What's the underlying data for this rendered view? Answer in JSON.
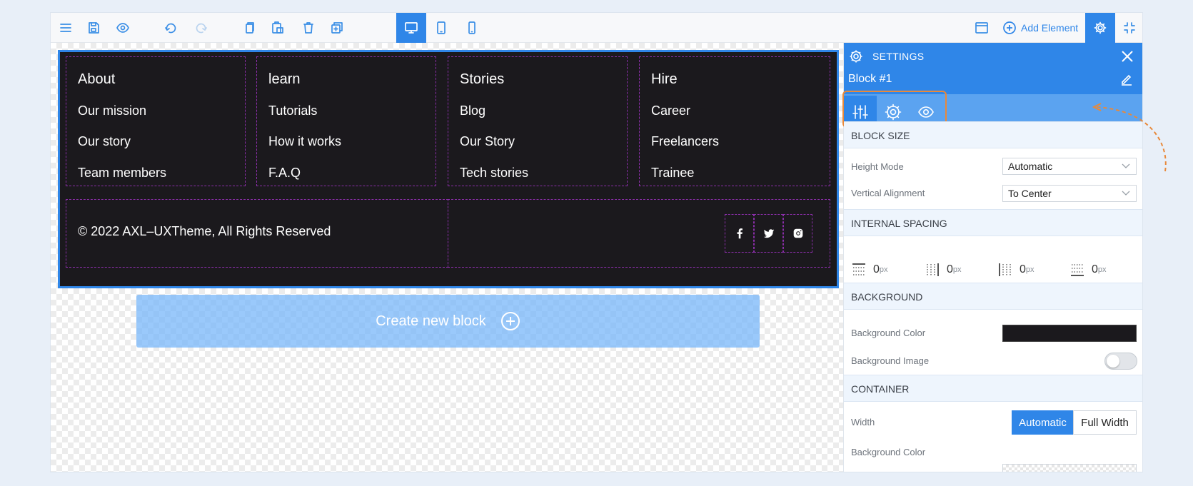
{
  "toolbar": {
    "add_element_label": "Add Element",
    "icons": [
      "menu-icon",
      "save-icon",
      "preview-icon",
      "undo-icon",
      "redo-icon",
      "copy-icon",
      "paste-icon",
      "delete-icon",
      "duplicate-icon",
      "desktop-icon",
      "tablet-icon",
      "mobile-icon",
      "layout-icon",
      "plus-circle-icon",
      "gear-icon",
      "collapse-icon"
    ],
    "active_device": "desktop"
  },
  "footer": {
    "columns": [
      {
        "title": "About",
        "links": [
          "Our mission",
          "Our story",
          "Team members"
        ]
      },
      {
        "title": "learn",
        "links": [
          "Tutorials",
          "How it works",
          "F.A.Q"
        ]
      },
      {
        "title": "Stories",
        "links": [
          "Blog",
          "Our Story",
          "Tech stories"
        ]
      },
      {
        "title": "Hire",
        "links": [
          "Career",
          "Freelancers",
          "Trainee"
        ]
      }
    ],
    "copyright": "© 2022  AXL–UXTheme, All Rights Reserved",
    "social": [
      "facebook-icon",
      "twitter-icon",
      "instagram-icon"
    ]
  },
  "canvas": {
    "create_block_label": "Create new block"
  },
  "settings": {
    "title": "SETTINGS",
    "block_name": "Block #1",
    "tabs": [
      "sliders-icon",
      "gear-icon",
      "eye-icon"
    ],
    "block_size": {
      "heading": "BLOCK SIZE",
      "height_mode_label": "Height Mode",
      "height_mode_value": "Automatic",
      "vertical_alignment_label": "Vertical Alignment",
      "vertical_alignment_value": "To Center"
    },
    "internal_spacing": {
      "heading": "INTERNAL SPACING",
      "values": [
        "0",
        "0",
        "0",
        "0"
      ],
      "unit": "px"
    },
    "background": {
      "heading": "BACKGROUND",
      "color_label": "Background Color",
      "color_value": "#1b191d",
      "image_label": "Background Image",
      "image_enabled": false
    },
    "container": {
      "heading": "CONTAINER",
      "width_label": "Width",
      "width_options": [
        "Automatic",
        "Full Width"
      ],
      "width_selected": "Automatic",
      "bg_color_label": "Background Color"
    }
  },
  "colors": {
    "accent": "#2f86e8",
    "footer_bg": "#1b191d",
    "column_border": "#8a2ea8",
    "highlight": "#e8893a"
  }
}
